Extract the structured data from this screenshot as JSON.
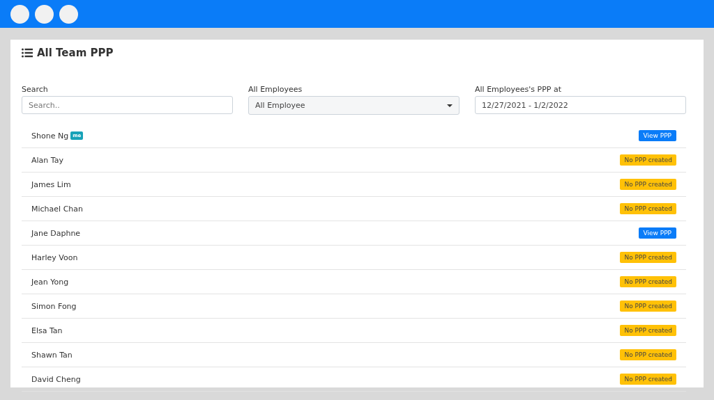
{
  "title": "All Team PPP",
  "filters": [
    {
      "label": "Search",
      "kind": "text",
      "placeholder": "Search.."
    },
    {
      "label": "All Employees",
      "kind": "select",
      "value": "All Employee"
    },
    {
      "label": "All Employees's PPP at",
      "kind": "text",
      "value": "12/27/2021 - 1/2/2022"
    }
  ],
  "employees": [
    {
      "name": "Shone Ng",
      "tag": "me",
      "status": {
        "kind": "button",
        "text": "View PPP"
      }
    },
    {
      "name": "Alan Tay",
      "status": {
        "kind": "badge",
        "text": "No PPP created"
      }
    },
    {
      "name": "James Lim",
      "status": {
        "kind": "badge",
        "text": "No PPP created"
      }
    },
    {
      "name": "Michael Chan",
      "status": {
        "kind": "badge",
        "text": "No PPP created"
      }
    },
    {
      "name": "Jane Daphne",
      "status": {
        "kind": "button",
        "text": "View PPP"
      }
    },
    {
      "name": "Harley Voon",
      "status": {
        "kind": "badge",
        "text": "No PPP created"
      }
    },
    {
      "name": "Jean Yong",
      "status": {
        "kind": "badge",
        "text": "No PPP created"
      }
    },
    {
      "name": "Simon Fong",
      "status": {
        "kind": "badge",
        "text": "No PPP created"
      }
    },
    {
      "name": "Elsa Tan",
      "status": {
        "kind": "badge",
        "text": "No PPP created"
      }
    },
    {
      "name": "Shawn Tan",
      "status": {
        "kind": "badge",
        "text": "No PPP created"
      }
    },
    {
      "name": "David Cheng",
      "status": {
        "kind": "badge",
        "text": "No PPP created"
      }
    }
  ]
}
